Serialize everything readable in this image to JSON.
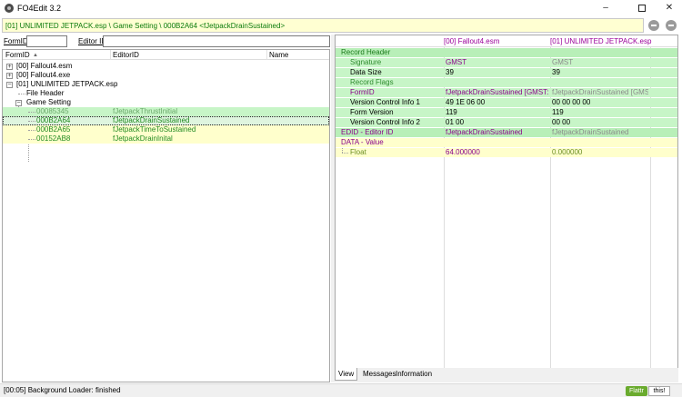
{
  "window": {
    "title": "FO4Edit 3.2",
    "icon": "fo4edit-app-icon",
    "minimize": "–",
    "close": "✕"
  },
  "path_bar": {
    "text": "[01] UNLIMITED JETPACK.esp \\ Game Setting \\ 000B2A64 <fJetpackDrainSustained>"
  },
  "filter": {
    "formid_label": "FormID",
    "formid_value": "",
    "editorid_label": "Editor ID",
    "editorid_value": ""
  },
  "tree": {
    "columns": [
      "FormID",
      "EditorID",
      "Name"
    ],
    "sort_indicator": "▲",
    "files": [
      {
        "label": "[00] Fallout4.esm",
        "expander": "+"
      },
      {
        "label": "[00] Fallout4.exe",
        "expander": "+"
      },
      {
        "label": "[01] UNLIMITED JETPACK.esp",
        "expander": "−"
      }
    ],
    "file_header": "File Header",
    "group": {
      "label": "Game Setting",
      "expander": "−"
    },
    "records": [
      {
        "formid": "00085345",
        "editorid": "fJetpackThrustInitial"
      },
      {
        "formid": "000B2A64",
        "editorid": "fJetpackDrainSustained"
      },
      {
        "formid": "000B2A65",
        "editorid": "fJetpackTimeToSustained"
      },
      {
        "formid": "00152AB8",
        "editorid": "fJetpackDrainInital"
      }
    ]
  },
  "grid": {
    "columns": {
      "master": "[00] Fallout4.esm",
      "plugin": "[01] UNLIMITED JETPACK.esp"
    },
    "rows": {
      "record_header": "Record Header",
      "signature": {
        "label": "Signature",
        "master": "GMST",
        "plugin": "GMST"
      },
      "data_size": {
        "label": "Data Size",
        "master": "39",
        "plugin": "39"
      },
      "record_flags": {
        "label": "Record Flags"
      },
      "formid": {
        "label": "FormID",
        "master": "fJetpackDrainSustained [GMST:00...",
        "plugin": "fJetpackDrainSustained [GMST:00..."
      },
      "vci1": {
        "label": "Version Control Info 1",
        "master": "49 1E 06 00",
        "plugin": "00 00 00 00"
      },
      "form_version": {
        "label": "Form Version",
        "master": "119",
        "plugin": "119"
      },
      "vci2": {
        "label": "Version Control Info 2",
        "master": "01 00",
        "plugin": "00 00"
      },
      "edid": {
        "label": "EDID - Editor ID",
        "master": "fJetpackDrainSustained",
        "plugin": "fJetpackDrainSustained"
      },
      "data_value": {
        "label": "DATA - Value"
      },
      "float": {
        "label": "Float",
        "master": "64.000000",
        "plugin": "0.000000"
      }
    }
  },
  "tabs": [
    "View",
    "Messages",
    "Information"
  ],
  "status": {
    "text": "[00:05] Background Loader: finished",
    "flattr": "Flattr",
    "flattr_this": "this!"
  }
}
